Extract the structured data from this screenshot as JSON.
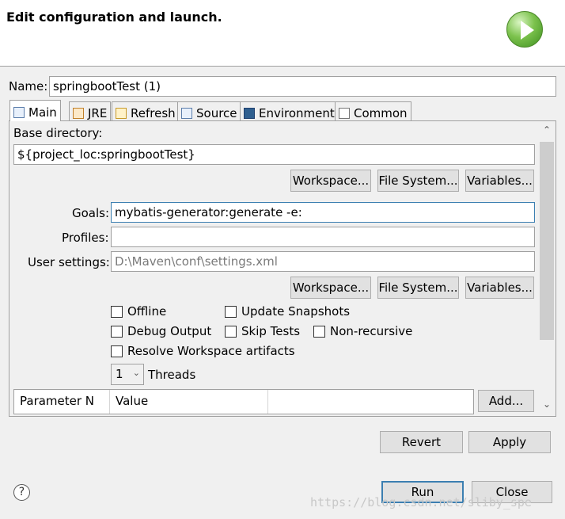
{
  "header": {
    "title": "Edit configuration and launch.",
    "logo_icon": "run-icon"
  },
  "name": {
    "label": "Name:",
    "value": "springbootTest (1)"
  },
  "tabs": [
    {
      "label": "Main",
      "icon": "main-tab-icon"
    },
    {
      "label": "JRE",
      "icon": "jre-icon"
    },
    {
      "label": "Refresh",
      "icon": "refresh-icon"
    },
    {
      "label": "Source",
      "icon": "source-icon"
    },
    {
      "label": "Environment",
      "icon": "environment-icon"
    },
    {
      "label": "Common",
      "icon": "common-icon"
    }
  ],
  "main": {
    "base_dir_label": "Base directory:",
    "base_dir_value": "${project_loc:springbootTest}",
    "buttons1": {
      "workspace": "Workspace...",
      "file_system": "File System...",
      "variables": "Variables..."
    },
    "goals_label": "Goals:",
    "goals_value": "mybatis-generator:generate -e:",
    "profiles_label": "Profiles:",
    "profiles_value": "",
    "user_settings_label": "User settings:",
    "user_settings_value": "D:\\Maven\\conf\\settings.xml",
    "buttons2": {
      "workspace": "Workspace...",
      "file_system": "File System...",
      "variables": "Variables..."
    },
    "checks": {
      "offline": "Offline",
      "update_snapshots": "Update Snapshots",
      "debug_output": "Debug Output",
      "skip_tests": "Skip Tests",
      "non_recursive": "Non-recursive",
      "resolve_workspace": "Resolve Workspace artifacts"
    },
    "threads_value": "1",
    "threads_label": "Threads",
    "param_table": {
      "col_name": "Parameter N",
      "col_value": "Value",
      "add_button": "Add..."
    }
  },
  "footer": {
    "revert": "Revert",
    "apply": "Apply",
    "run": "Run",
    "close": "Close",
    "help_icon": "help-icon"
  },
  "watermark": "https://blog.csdn.net/sliby_spe"
}
